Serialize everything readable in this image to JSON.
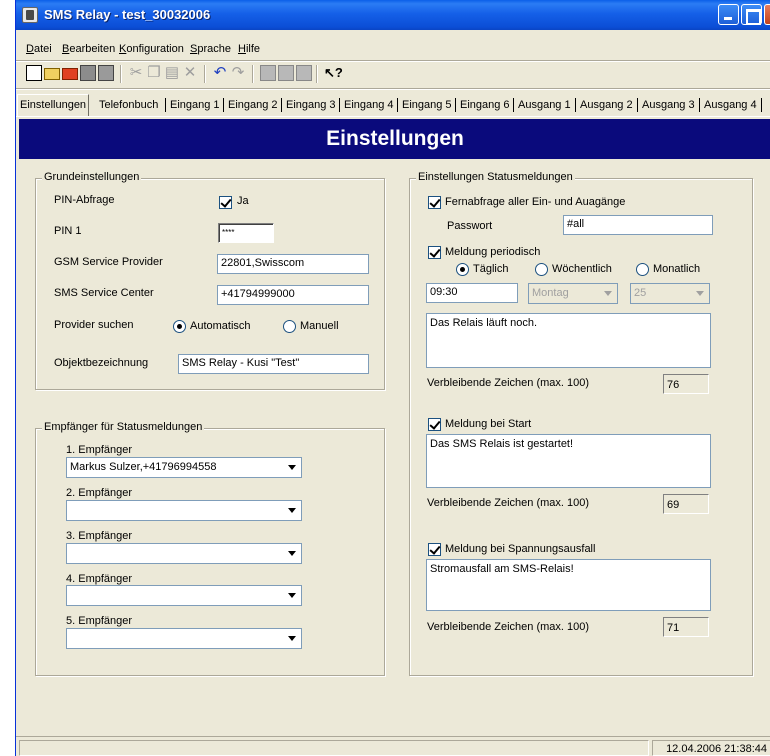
{
  "window": {
    "title": "SMS Relay - test_30032006"
  },
  "menu": [
    {
      "ul": "D",
      "rest": "atei"
    },
    {
      "ul": "B",
      "rest": "earbeiten"
    },
    {
      "ul": "K",
      "rest": "onfiguration"
    },
    {
      "ul": "S",
      "rest": "prache"
    },
    {
      "ul": "H",
      "rest": "ilfe"
    }
  ],
  "toolbar_icons": [
    "new-icon",
    "open-icon",
    "open-red-icon",
    "save-icon",
    "print-icon",
    "cut-icon",
    "copy-icon",
    "paste-icon",
    "delete-icon",
    "undo-icon",
    "redo-icon",
    "tool-a-icon",
    "tool-b-icon",
    "tool-c-icon",
    "context-help-icon"
  ],
  "tabs": [
    "Einstellungen",
    "Telefonbuch",
    "Eingang 1",
    "Eingang 2",
    "Eingang 3",
    "Eingang 4",
    "Eingang 5",
    "Eingang 6",
    "Ausgang 1",
    "Ausgang 2",
    "Ausgang 3",
    "Ausgang 4"
  ],
  "banner": "Einstellungen",
  "grund": {
    "title": "Grundeinstellungen",
    "pin_abfrage_label": "PIN-Abfrage",
    "pin_abfrage_check": "Ja",
    "pin1_label": "PIN 1",
    "pin1_value": "****",
    "gsm_label": "GSM Service Provider",
    "gsm_value": "22801,Swisscom",
    "smsc_label": "SMS Service Center",
    "smsc_value": "+41794999000",
    "provider_label": "Provider suchen",
    "provider_auto": "Automatisch",
    "provider_manual": "Manuell",
    "objekt_label": "Objektbezeichnung",
    "objekt_value": "SMS Relay - Kusi \"Test\""
  },
  "empf": {
    "title": "Empfänger für Statusmeldungen",
    "items": [
      {
        "label": "1. Empfänger",
        "value": "Markus Sulzer,+41796994558"
      },
      {
        "label": "2. Empfänger",
        "value": ""
      },
      {
        "label": "3. Empfänger",
        "value": ""
      },
      {
        "label": "4. Empfänger",
        "value": ""
      },
      {
        "label": "5. Empfänger",
        "value": ""
      }
    ]
  },
  "status": {
    "title": "Einstellungen Statusmeldungen",
    "fern_check": "Fernabfrage aller Ein- und Auagänge",
    "passwort_label": "Passwort",
    "passwort_value": "#all",
    "periodisch_check": "Meldung periodisch",
    "taeglich": "Täglich",
    "woechentlich": "Wöchentlich",
    "monatlich": "Monatlich",
    "time_value": "09:30",
    "weekday_value": "Montag",
    "monthday_value": "25",
    "periodisch_text": "Das Relais läuft noch.",
    "remaining_label_1": "Verbleibende Zeichen (max. 100)",
    "remaining_1": "76",
    "start_check": "Meldung bei Start",
    "start_text": "Das SMS Relais ist gestartet!",
    "remaining_label_2": "Verbleibende Zeichen (max. 100)",
    "remaining_2": "69",
    "spannung_check": "Meldung bei Spannungsausfall",
    "spannung_text": "Stromausfall am SMS-Relais!",
    "remaining_label_3": "Verbleibende Zeichen (max. 100)",
    "remaining_3": "71"
  },
  "statusbar": {
    "datetime": "12.04.2006 21:38:44"
  }
}
